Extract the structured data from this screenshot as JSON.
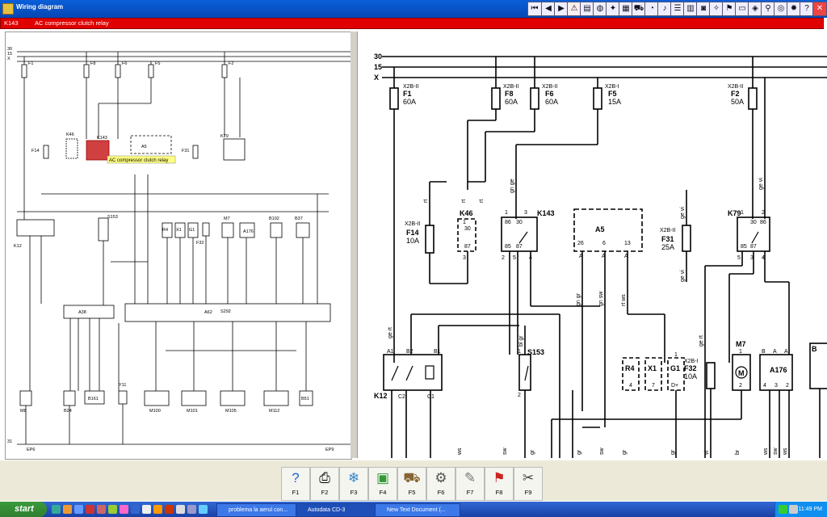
{
  "window": {
    "title": "Wiring diagram"
  },
  "toolbar": {
    "icons": [
      "first-icon",
      "prev-icon",
      "next-icon",
      "warning-icon",
      "book-icon",
      "globe-icon",
      "compass-icon",
      "chip-icon",
      "car-icon",
      "gauge-icon",
      "bell-icon",
      "list-icon",
      "bars-icon",
      "camera-icon",
      "key-icon",
      "flag-icon",
      "paper-icon",
      "disk-icon",
      "plug-icon",
      "cd-icon",
      "flame-icon",
      "help-icon",
      "close-icon"
    ]
  },
  "header": {
    "code": "K143",
    "description": "AC compressor clutch relay"
  },
  "left": {
    "rails": [
      "30",
      "15",
      "X",
      "31"
    ],
    "fuses": [
      {
        "conn": "X2B-II",
        "name": "F1",
        "amp": "60A"
      },
      {
        "conn": "X2B-II",
        "name": "F8",
        "amp": "60A"
      },
      {
        "conn": "X2B-I",
        "name": "F6",
        "amp": "60A"
      },
      {
        "conn": "X2B-I",
        "name": "F5",
        "amp": "15A"
      },
      {
        "conn": "X2B-I",
        "name": "F2",
        "amp": "50A"
      }
    ],
    "labels": {
      "f14": "F14",
      "k46": "K46",
      "k143": "K143",
      "a5": "A5",
      "f31": "F31",
      "k79": "K79",
      "k12": "K12",
      "s153": "S153",
      "r4": "R4",
      "x1": "X1",
      "g1": "G1",
      "f32": "F32",
      "m7": "M7",
      "a176": "A176",
      "b102": "B102",
      "b37": "B37",
      "a38": "A38",
      "a62": "A62",
      "s292": "S292",
      "m8": "M8",
      "b24": "B24",
      "b161": "B161",
      "y11": "Y11",
      "m100": "M100",
      "m101": "M101",
      "m105": "M105",
      "m112": "M112",
      "b51": "B51",
      "ep6": "EP6",
      "ep9": "EP9"
    },
    "tooltip": "AC compressor clutch relay"
  },
  "right": {
    "rails": [
      "30",
      "15",
      "X"
    ],
    "fuses": [
      {
        "conn": "X2B-II",
        "name": "F1",
        "amp": "60A"
      },
      {
        "conn": "X2B-II",
        "name": "F8",
        "amp": "60A"
      },
      {
        "conn": "X2B-II",
        "name": "F6",
        "amp": "60A"
      },
      {
        "conn": "X2B-I",
        "name": "F5",
        "amp": "15A"
      },
      {
        "conn": "X2B-II",
        "name": "F2",
        "amp": "50A"
      }
    ],
    "f14": {
      "conn": "X2B-II",
      "name": "F14",
      "amp": "10A"
    },
    "f31": {
      "conn": "X2B-II",
      "name": "F31",
      "amp": "25A"
    },
    "f32": {
      "conn": "X2B-I",
      "name": "F32",
      "amp": "10A"
    },
    "components": {
      "k46": "K46",
      "k143": "K143",
      "a5": "A5",
      "k79": "K79",
      "k12": "K12",
      "s153": "S153",
      "r4": "R4",
      "x1": "X1",
      "g1": "G1",
      "m7": "M7",
      "a176": "A176",
      "b": "B"
    },
    "wires": {
      "rt": "rt",
      "gn_ge": "gn ge",
      "ge_vi": "ge vi",
      "ge_rt": "ge rt",
      "bl_gr": "bl gr",
      "gn_gr": "gn gr",
      "gn_sw": "gn sw",
      "rt_ws": "rt ws",
      "ge_vi2": "ge vi",
      "ws": "ws",
      "sw": "sw",
      "gr": "gr",
      "br": "br",
      "vi": "vi"
    },
    "pins": {
      "k46": [
        "1",
        "30",
        "87",
        "3"
      ],
      "k143": [
        "1",
        "3",
        "86",
        "30",
        "85",
        "87",
        "2",
        "5",
        "4"
      ],
      "a5": [
        "26",
        "6",
        "13",
        "A",
        "A",
        "A"
      ],
      "k79": [
        "1",
        "30",
        "86",
        "2",
        "87",
        "85",
        "5",
        "3",
        "4"
      ],
      "k12": [
        "A1",
        "B2",
        "B1",
        "C2",
        "C1"
      ],
      "s153": [
        "1",
        "2"
      ],
      "r4": [
        "4"
      ],
      "x1": [
        "7"
      ],
      "g1": [
        "1",
        "D+"
      ],
      "m7": [
        "1",
        "2"
      ],
      "a176": [
        "B",
        "A",
        "A",
        "4",
        "3",
        "2"
      ]
    }
  },
  "fkeys": [
    {
      "key": "F1",
      "icon": "help-icon",
      "glyph": "?"
    },
    {
      "key": "F2",
      "icon": "printer-icon",
      "glyph": "⎙"
    },
    {
      "key": "F3",
      "icon": "ac-icon",
      "glyph": "❄"
    },
    {
      "key": "F4",
      "icon": "car-chip-icon",
      "glyph": "▣"
    },
    {
      "key": "F5",
      "icon": "car-icon",
      "glyph": "⛟"
    },
    {
      "key": "F6",
      "icon": "engine-icon",
      "glyph": "⚙"
    },
    {
      "key": "F7",
      "icon": "wrench-icon",
      "glyph": "✎"
    },
    {
      "key": "F8",
      "icon": "flag-icon",
      "glyph": "⚑"
    },
    {
      "key": "F9",
      "icon": "tools-icon",
      "glyph": "✂"
    }
  ],
  "taskbar": {
    "start": "start",
    "tasks": [
      "problema la aerul con...",
      "Autodata CD-3",
      "New Text Document (..."
    ],
    "clock": "11:49 PM"
  },
  "colors": {
    "title": "#0a5fd8",
    "header": "#e00000",
    "highlight": "#d04040",
    "tooltip": "#ffff80"
  }
}
